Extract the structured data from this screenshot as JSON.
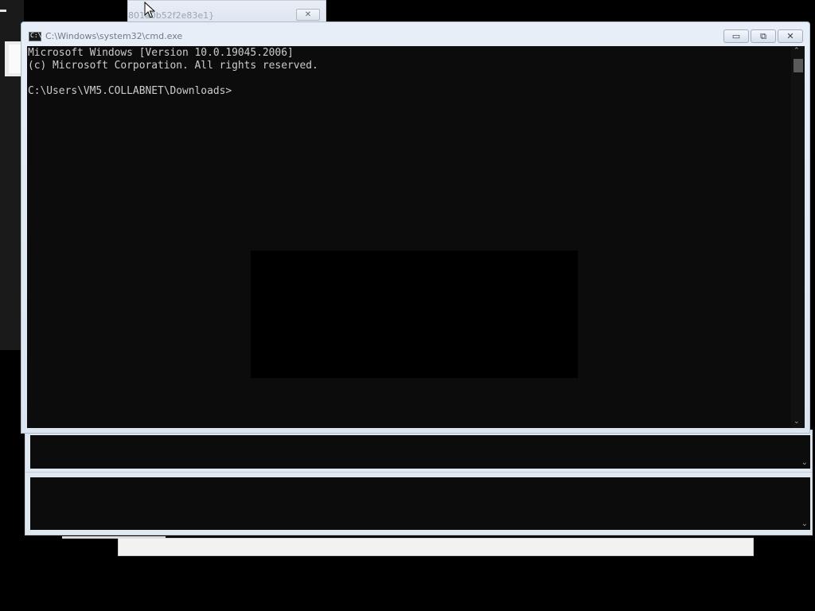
{
  "background": {
    "top_window": {
      "title": "801a̶0b52f2e83e1}",
      "close_label": "✕"
    },
    "stacked_windows": [
      {
        "chevron": "⌄"
      },
      {
        "chevron": "⌄"
      }
    ]
  },
  "main_window": {
    "title": "C:\\Windows\\system32\\cmd.exe",
    "icon_text": "C:\\",
    "buttons": {
      "minimize": "▭",
      "maximize": "⧉",
      "close": "✕"
    },
    "console": {
      "lines": [
        "Microsoft Windows [Version 10.0.19045.2006]",
        "(c) Microsoft Corporation. All rights reserved.",
        "",
        "C:\\Users\\VM5.COLLABNET\\Downloads>"
      ]
    },
    "scrollbar": {
      "up": "⌃",
      "down": "⌄"
    }
  },
  "colors": {
    "console_bg": "#0c0c0c",
    "console_text": "#cccccc",
    "window_frame": "#dfe7f1"
  }
}
